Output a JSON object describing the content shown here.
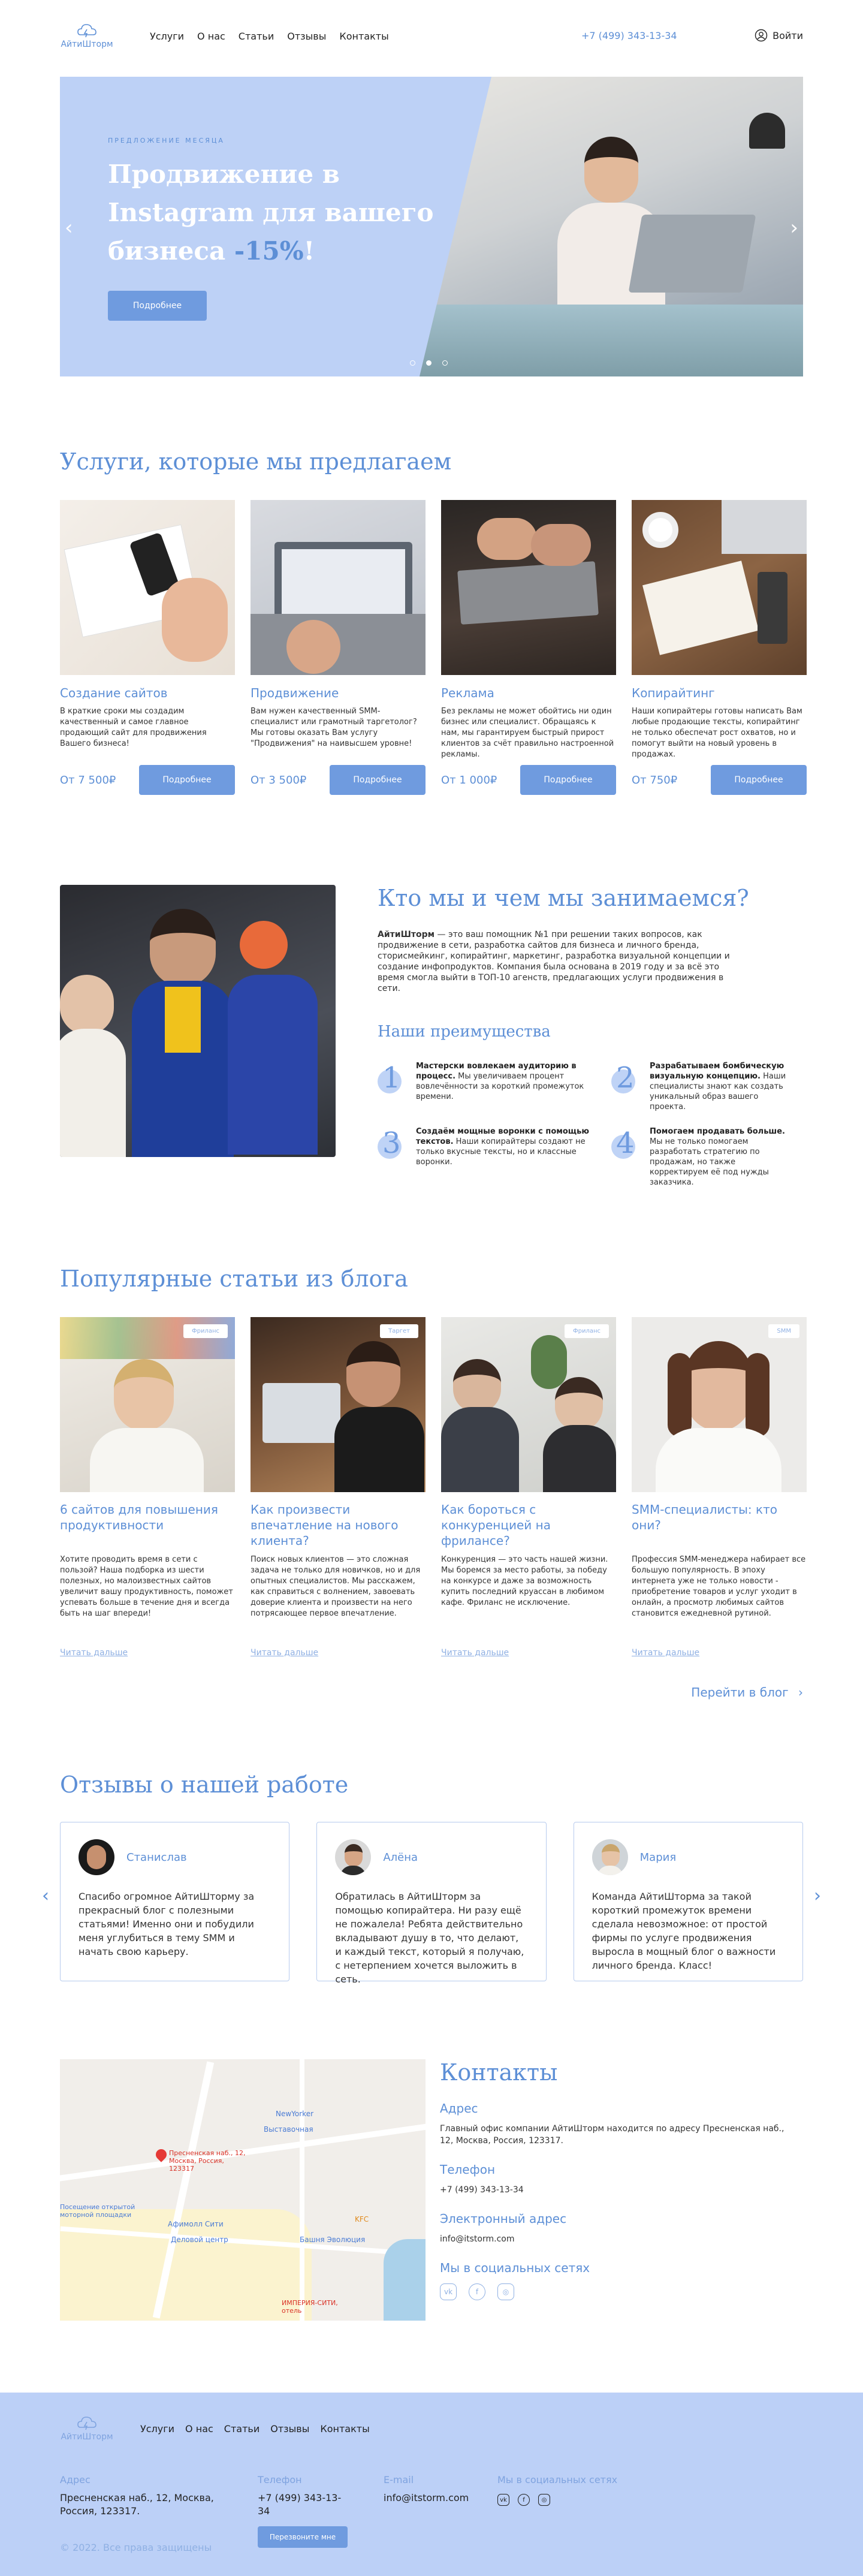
{
  "header": {
    "logo_text": "АйтиШторм",
    "nav": [
      "Услуги",
      "О нас",
      "Статьи",
      "Отзывы",
      "Контакты"
    ],
    "phone": "+7 (499) 343-13-34",
    "login": "Войти"
  },
  "hero": {
    "kicker": "Предложение месяца",
    "title_main": "Продвижение в Instagram для вашего бизнеса ",
    "title_discount": "-15%",
    "title_end": "!",
    "button": "Подробнее",
    "slides_total": 3,
    "active_slide": 2
  },
  "services": {
    "title": "Услуги, которые мы предлагаем",
    "items": [
      {
        "title": "Создание сайтов",
        "text": "В краткие сроки мы создадим качественный и самое главное продающий сайт для продвижения Вашего бизнеса!",
        "price": "От 7 500₽",
        "button": "Подробнее"
      },
      {
        "title": "Продвижение",
        "text": "Вам нужен качественный SMM-специалист или грамотный таргетолог? Мы готовы оказать Вам услугу \"Продвижения\" на наивысшем уровне!",
        "price": "От 3 500₽",
        "button": "Подробнее"
      },
      {
        "title": "Реклама",
        "text": "Без рекламы не может обойтись ни один бизнес или специалист. Обращаясь к нам, мы гарантируем быстрый прирост клиентов за счёт правильно настроенной рекламы.",
        "price": "От 1 000₽",
        "button": "Подробнее"
      },
      {
        "title": "Копирайтинг",
        "text": "Наши копирайтеры готовы написать Вам любые продающие тексты, копирайтинг не только обеспечат рост охватов, но и помогут выйти на новый уровень в продажах.",
        "price": "От 750₽",
        "button": "Подробнее"
      }
    ]
  },
  "about": {
    "title": "Кто мы и чем мы занимаемся?",
    "text_bold": "АйтиШторм",
    "text": " — это ваш помощник №1 при решении таких вопросов, как продвижение в сети, разработка сайтов для бизнеса и личного бренда, сторисмейкинг, копирайтинг, маркетинг, разработка визуальной концепции и создание инфопродуктов. Компания была основана в 2019 году и за всё это время смогла выйти в ТОП-10 агенств, предлагающих услуги продвижения в сети.",
    "adv_title": "Наши преимущества",
    "advantages": [
      {
        "num": "1",
        "bold": "Мастерски вовлекаем аудиторию в процесс.",
        "text": " Мы увеличиваем процент вовлечённости за короткий промежуток времени."
      },
      {
        "num": "2",
        "bold": "Разрабатываем бомбическую визуальную концепцию.",
        "text": " Наши специалисты знают как создать уникальный образ вашего проекта."
      },
      {
        "num": "3",
        "bold": "Создаём мощные воронки с помощью текстов.",
        "text": " Наши копирайтеры создают не только вкусные тексты, но и классные воронки."
      },
      {
        "num": "4",
        "bold": "Помогаем продавать больше.",
        "text": " Мы не только помогаем разработать стратегию по продажам, но также корректируем её под нужды заказчика."
      }
    ]
  },
  "blog": {
    "title": "Популярные статьи из блога",
    "posts": [
      {
        "tag": "Фриланс",
        "title": "6 сайтов для повышения продуктивности",
        "text": "Хотите проводить время в сети с пользой? Наша подборка из шести полезных, но малоизвестных сайтов увеличит вашу продуктивность, поможет успевать больше в течение дня и всегда быть на шаг впереди!",
        "link": "Читать дальше"
      },
      {
        "tag": "Таргет",
        "title": "Как произвести впечатление на нового клиента?",
        "text": "Поиск новых клиентов — это сложная задача не только для новичков, но и для опытных специалистов. Мы расскажем, как справиться с волнением, завоевать доверие клиента и произвести на него потрясающее первое впечатление.",
        "link": "Читать дальше"
      },
      {
        "tag": "Фриланс",
        "title": "Как бороться с конкуренцией на фрилансе?",
        "text": "Конкуренция — это часть нашей жизни. Мы боремся за место работы, за победу на конкурсе и даже за возможность купить последний круассан в любимом кафе. Фриланс не исключение.",
        "link": "Читать дальше"
      },
      {
        "tag": "SMM",
        "title": "SMM-специалисты: кто они?",
        "text": "Профессия SMM-менеджера набирает все большую популярность. В эпоху интернета уже не только новости - приобретение товаров и услуг уходит в онлайн, а просмотр любимых сайтов становится ежедневной рутиной.",
        "link": "Читать дальше"
      }
    ],
    "more": "Перейти в блог"
  },
  "reviews": {
    "title": "Отзывы о нашей работе",
    "items": [
      {
        "name": "Станислав",
        "text": "Спасибо огромное АйтиШторму за прекрасный блог с полезными статьями! Именно они и побудили меня углубиться в тему SMM и начать свою карьеру."
      },
      {
        "name": "Алёна",
        "text": "Обратилась в АйтиШторм за помощью копирайтера. Ни разу ещё не пожалела! Ребята действительно вкладывают душу в то, что делают, и каждый текст, который я получаю, с нетерпением хочется выложить в сеть."
      },
      {
        "name": "Мария",
        "text": "Команда АйтиШторма за такой короткий промежуток времени сделала невозможное: от простой фирмы по услуге продвижения выросла в мощный блог о важности личного бренда. Класс!"
      }
    ]
  },
  "contacts": {
    "title": "Контакты",
    "address_h": "Адрес",
    "address": "Главный офис компании АйтиШторм находится по адресу Пресненская наб., 12, Москва, Россия, 123317.",
    "phone_h": "Телефон",
    "phone": "+7 (499) 343-13-34",
    "email_h": "Электронный адрес",
    "email": "info@itstorm.com",
    "social_h": "Мы в социальных сетях",
    "socials": [
      "vk",
      "facebook",
      "instagram"
    ],
    "map": {
      "labels": [
        "Пресненская наб., 12, Москва, Россия, 123317",
        "Выставочная",
        "NewYorker",
        "Посещение открытой моторной площадки",
        "Афимолл Сити",
        "Деловой центр",
        "Башня Эволюция",
        "KFC",
        "ИМПЕРИЯ-СИТИ, отель"
      ]
    }
  },
  "footer": {
    "logo_text": "АйтиШторм",
    "nav": [
      "Услуги",
      "О нас",
      "Статьи",
      "Отзывы",
      "Контакты"
    ],
    "address_h": "Адрес",
    "address": "Пресненская наб., 12, Москва, Россия, 123317.",
    "phone_h": "Телефон",
    "phone": "+7 (499) 343-13-34",
    "callback": "Перезвоните мне",
    "email_h": "E-mail",
    "email": "info@itstorm.com",
    "social_h": "Мы в социальных сетях",
    "copyright": "© 2022. Все права защищены"
  },
  "colors": {
    "accent": "#5d8fd6",
    "button": "#6f9bdf",
    "light": "#bcd0f7"
  }
}
